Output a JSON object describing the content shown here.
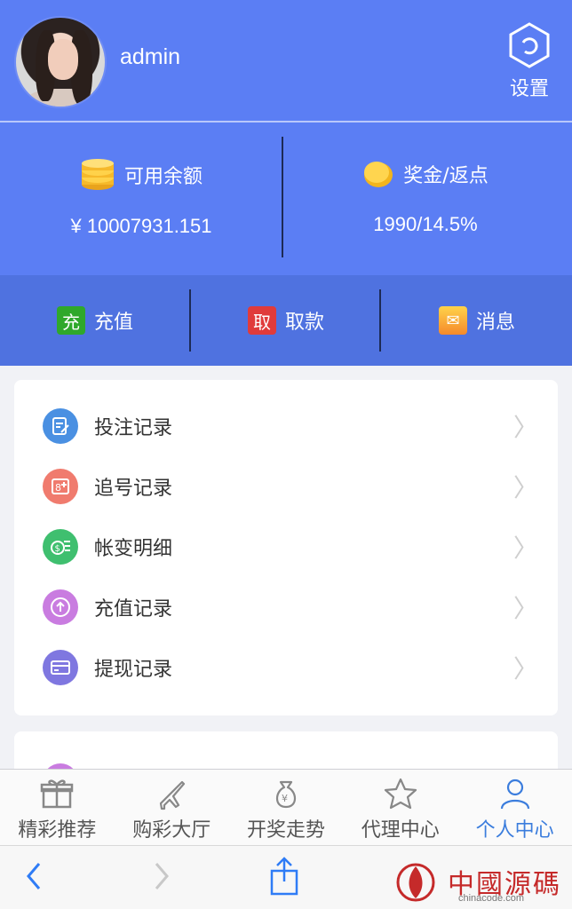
{
  "header": {
    "username": "admin",
    "settings_label": "设置",
    "avatar_icon": "user-avatar-photo",
    "settings_icon": "gear-icon"
  },
  "balance": {
    "available_label": "可用余额",
    "available_value": "¥ 10007931.151",
    "bonus_label": "奖金/返点",
    "bonus_value": "1990/14.5%"
  },
  "actions": [
    {
      "badge": "充",
      "label": "充值",
      "color": "#2fa82b"
    },
    {
      "badge": "取",
      "label": "取款",
      "color": "#e03b3b"
    },
    {
      "badge": "✉",
      "label": "消息",
      "color": "#f5a623"
    }
  ],
  "menu": [
    {
      "label": "投注记录",
      "icon": "edit-note-icon",
      "color": "#4a90e2"
    },
    {
      "label": "追号记录",
      "icon": "number-plus-icon",
      "color": "#f07b6e"
    },
    {
      "label": "帐变明细",
      "icon": "money-stack-icon",
      "color": "#3fbf6f"
    },
    {
      "label": "充值记录",
      "icon": "arrow-up-circle-icon",
      "color": "#c97ce0"
    },
    {
      "label": "提现记录",
      "icon": "card-icon",
      "color": "#7f77e0"
    }
  ],
  "tabs": [
    {
      "label": "精彩推荐",
      "icon": "gift-icon",
      "active": false
    },
    {
      "label": "购彩大厅",
      "icon": "plane-icon",
      "active": false
    },
    {
      "label": "开奖走势",
      "icon": "money-bag-icon",
      "active": false
    },
    {
      "label": "代理中心",
      "icon": "star-icon",
      "active": false
    },
    {
      "label": "个人中心",
      "icon": "person-icon",
      "active": true
    }
  ],
  "watermark": {
    "text": "中國源碼",
    "sub": "chinacode.com"
  },
  "colors": {
    "header_bg": "#5b7ef4",
    "action_bg": "#4f72e0",
    "active_tab": "#3b7ddd"
  }
}
